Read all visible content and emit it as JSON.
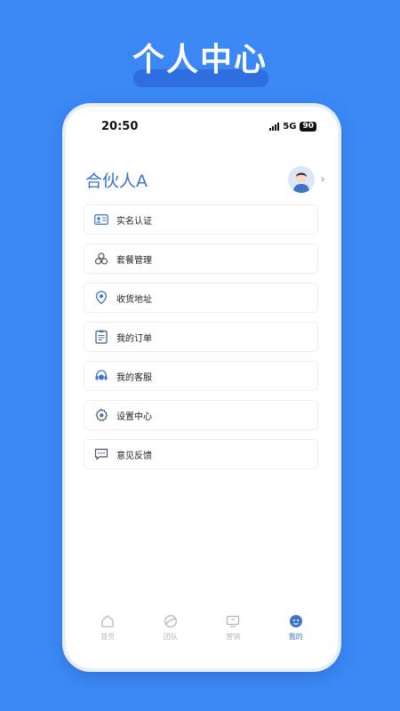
{
  "banner": {
    "title": "个人中心"
  },
  "status_bar": {
    "time": "20:50",
    "network": "5G",
    "battery": "90"
  },
  "profile": {
    "name": "合伙人A",
    "chevron": "›"
  },
  "menu": [
    {
      "label": "实名认证",
      "icon": "id-card-icon"
    },
    {
      "label": "套餐管理",
      "icon": "package-icon"
    },
    {
      "label": "收货地址",
      "icon": "location-pin-icon"
    },
    {
      "label": "我的订单",
      "icon": "order-list-icon"
    },
    {
      "label": "我的客服",
      "icon": "headset-icon"
    },
    {
      "label": "设置中心",
      "icon": "gear-icon"
    },
    {
      "label": "意见反馈",
      "icon": "feedback-icon"
    }
  ],
  "tabbar": [
    {
      "label": "首页",
      "icon": "home-icon",
      "active": false
    },
    {
      "label": "团队",
      "icon": "team-icon",
      "active": false
    },
    {
      "label": "营销",
      "icon": "marketing-icon",
      "active": false
    },
    {
      "label": "我的",
      "icon": "profile-icon",
      "active": true
    }
  ],
  "colors": {
    "background": "#3a87f5",
    "accent": "#3b74c8",
    "inactive": "#b2b8c0"
  }
}
